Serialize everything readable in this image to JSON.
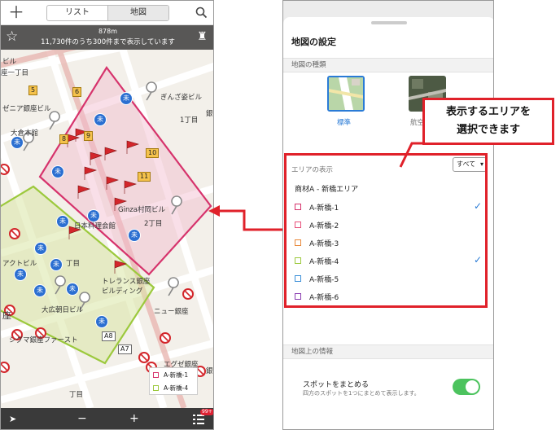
{
  "left": {
    "tabs": [
      "リスト",
      "地図"
    ],
    "active_tab": "地図",
    "scale": "878m",
    "count_text": "11,730件のうち300件まで表示しています",
    "map_labels": [
      "座一丁目",
      "ゼニア銀座ビル",
      "ぎんざ姿ビル",
      "大倉本館",
      "1丁目",
      "Ginza村岡ビル",
      "2丁目",
      "日本料理会館",
      "アクトビル",
      "丁目",
      "トレランス銀座",
      "ビルディング",
      "大広朝日ビル",
      "ニュー銀座",
      "シグマ銀座ファースト",
      "エグゼ銀座",
      "丁目",
      "銀",
      "ビル",
      "座",
      "銀"
    ],
    "num_markers": [
      "5",
      "6",
      "8",
      "9",
      "10",
      "11",
      "A8",
      "A7"
    ],
    "pin_label": "未",
    "legend": [
      "A-新橋-1",
      "A-新橋-4"
    ],
    "bottom": {
      "minus": "−",
      "plus": "+",
      "badge": "99+"
    }
  },
  "right": {
    "title": "地図の設定",
    "section_map_type": "地図の種類",
    "map_types": [
      "標準",
      "航空"
    ],
    "section_area": "エリアの表示",
    "select_all": "すべて",
    "area_group": "商材A - 新橋エリア",
    "areas": [
      {
        "name": "A-新橋-1",
        "color": "#d6336c",
        "checked": true
      },
      {
        "name": "A-新橋-2",
        "color": "#e8507a",
        "checked": false
      },
      {
        "name": "A-新橋-3",
        "color": "#e8883a",
        "checked": false
      },
      {
        "name": "A-新橋-4",
        "color": "#9cc93d",
        "checked": true
      },
      {
        "name": "A-新橋-5",
        "color": "#3b8fd8",
        "checked": false
      },
      {
        "name": "A-新橋-6",
        "color": "#8a3db0",
        "checked": false
      }
    ],
    "check_mark": "✓",
    "section_info": "地図上の情報",
    "spot_title": "スポットをまとめる",
    "spot_desc": "四方のスポットを1つにまとめて表示します。",
    "spot_enabled": true
  },
  "callout": {
    "line1": "表示するエリアを",
    "line2": "選択できます"
  },
  "colors": {
    "accent": "#e0212a",
    "selected_blue": "#2a7bd6",
    "toggle_green": "#4cc35e",
    "area1": "#d6336c",
    "area4": "#9cc93d"
  }
}
